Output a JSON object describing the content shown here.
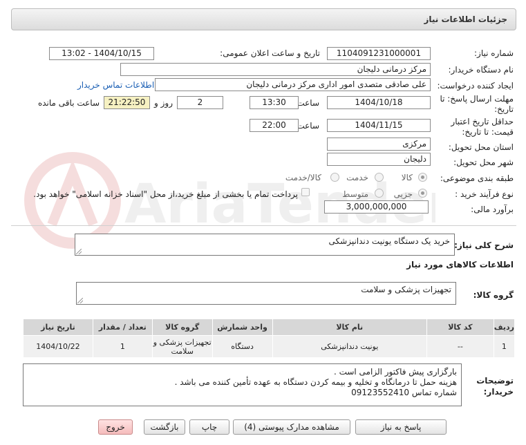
{
  "header": {
    "title": "جزئیات اطلاعات نیاز"
  },
  "form": {
    "need_number_label": "شماره نیاز:",
    "need_number": "1104091231000001",
    "announce_label": "تاریخ و ساعت اعلان عمومی:",
    "announce_value": "1404/10/15 - 13:02",
    "buyer_label": "نام دستگاه خریدار:",
    "buyer": "مرکز درمانی دلیجان",
    "creator_label": "ایجاد کننده درخواست:",
    "creator": "علی صادقی متصدی امور اداری مرکز درمانی دلیجان",
    "contact_link": "اطلاعات تماس خریدار",
    "reply_label_1": "مهلت ارسال پاسخ: تا",
    "reply_label_2": "تاریخ:",
    "reply_date": "1404/10/18",
    "time_label": "ساعت",
    "reply_time": "13:30",
    "days": "2",
    "days_label": "روز و",
    "remaining": "21:22:50",
    "remaining_label": "ساعت باقی مانده",
    "validity_label_1": "حداقل تاریخ اعتبار",
    "validity_label_2": "قیمت: تا تاریخ:",
    "validity_date": "1404/11/15",
    "validity_time": "22:00",
    "province_label": "استان محل تحویل:",
    "province": "مرکزی",
    "city_label": "شهر محل تحویل:",
    "city": "دلیجان",
    "category_label": "طبقه بندی موضوعی:",
    "category_options": [
      "کالا",
      "خدمت",
      "کالا/خدمت"
    ],
    "process_label": "نوع فرآیند خرید :",
    "process_options": [
      "جزیی",
      "متوسط"
    ],
    "payment_note": "پرداخت تمام یا بخشی از مبلغ خرید،از محل \"اسناد خزانه اسلامی\" خواهد بود.",
    "estimate_label": "برآورد مالی:",
    "estimate": "3,000,000,000"
  },
  "summary": {
    "label": "شرح کلی نیاز:",
    "value": "خرید یک دستگاه یونیت دندانپزشکی"
  },
  "goods": {
    "section_title": "اطلاعات کالاهای مورد نیاز",
    "group_label": "گروه کالا:",
    "group_value": "تجهیزات پزشکی و سلامت"
  },
  "table": {
    "headers": [
      "ردیف",
      "کد کالا",
      "نام کالا",
      "واحد شمارش",
      "گروه کالا",
      "تعداد / مقدار",
      "تاریخ نیاز"
    ],
    "rows": [
      [
        "1",
        "--",
        "یونیت دندانپزشکی",
        "دستگاه",
        "تجهیزات پزشکی و سلامت",
        "1",
        "1404/10/22"
      ]
    ]
  },
  "notes": {
    "label_1": "توضیحات",
    "label_2": "خریدار:",
    "lines": [
      "بارگزاری پیش فاکتور الزامی است .",
      "هزینه حمل تا درمانگاه و تخلیه و بیمه کردن دستگاه به عهده تأمین کننده می باشد .",
      "شماره تماس 09123552410"
    ]
  },
  "buttons": {
    "reply": "پاسخ به نیاز",
    "attachments": "مشاهده مدارک پیوستی (4)",
    "print": "چاپ",
    "back": "بازگشت",
    "exit": "خروج"
  },
  "colors": {
    "highlight": "#f6f1c2",
    "link": "#1a5fb4",
    "exit_button": "#f5bcbc"
  }
}
